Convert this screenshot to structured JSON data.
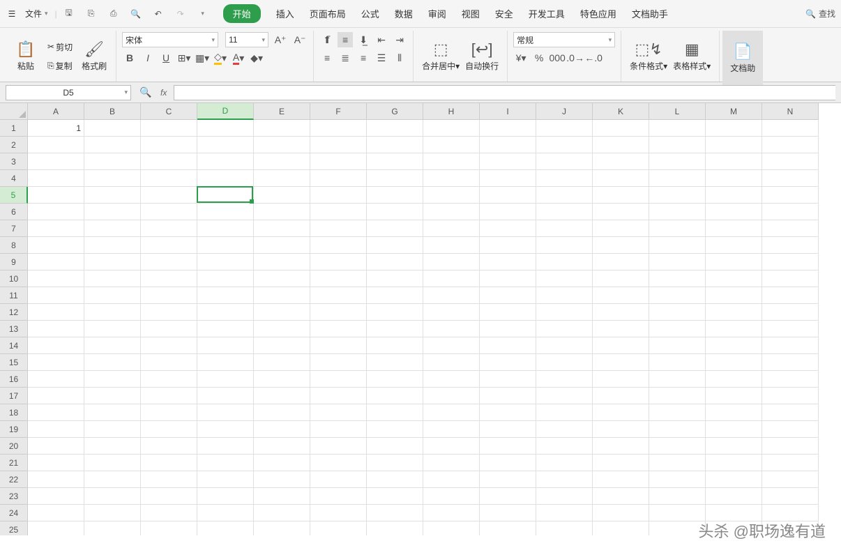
{
  "topbar": {
    "file_label": "文件",
    "tabs": [
      "开始",
      "插入",
      "页面布局",
      "公式",
      "数据",
      "审阅",
      "视图",
      "安全",
      "开发工具",
      "特色应用",
      "文档助手"
    ],
    "find_label": "查找"
  },
  "ribbon": {
    "paste": "粘贴",
    "cut": "剪切",
    "copy": "复制",
    "format_painter": "格式刷",
    "font_name": "宋体",
    "font_size": "11",
    "merge_center": "合并居中",
    "wrap_text": "自动换行",
    "number_format": "常规",
    "cond_format": "条件格式",
    "table_style": "表格样式",
    "doc_assist": "文档助"
  },
  "formula": {
    "name_box": "D5",
    "fx": ""
  },
  "grid": {
    "columns": [
      "A",
      "B",
      "C",
      "D",
      "E",
      "F",
      "G",
      "H",
      "I",
      "J",
      "K",
      "L",
      "M",
      "N"
    ],
    "row_count": 25,
    "cell_A1": "1",
    "active": {
      "col": 3,
      "row": 4
    }
  },
  "watermark": "头杀 @职场逸有道"
}
